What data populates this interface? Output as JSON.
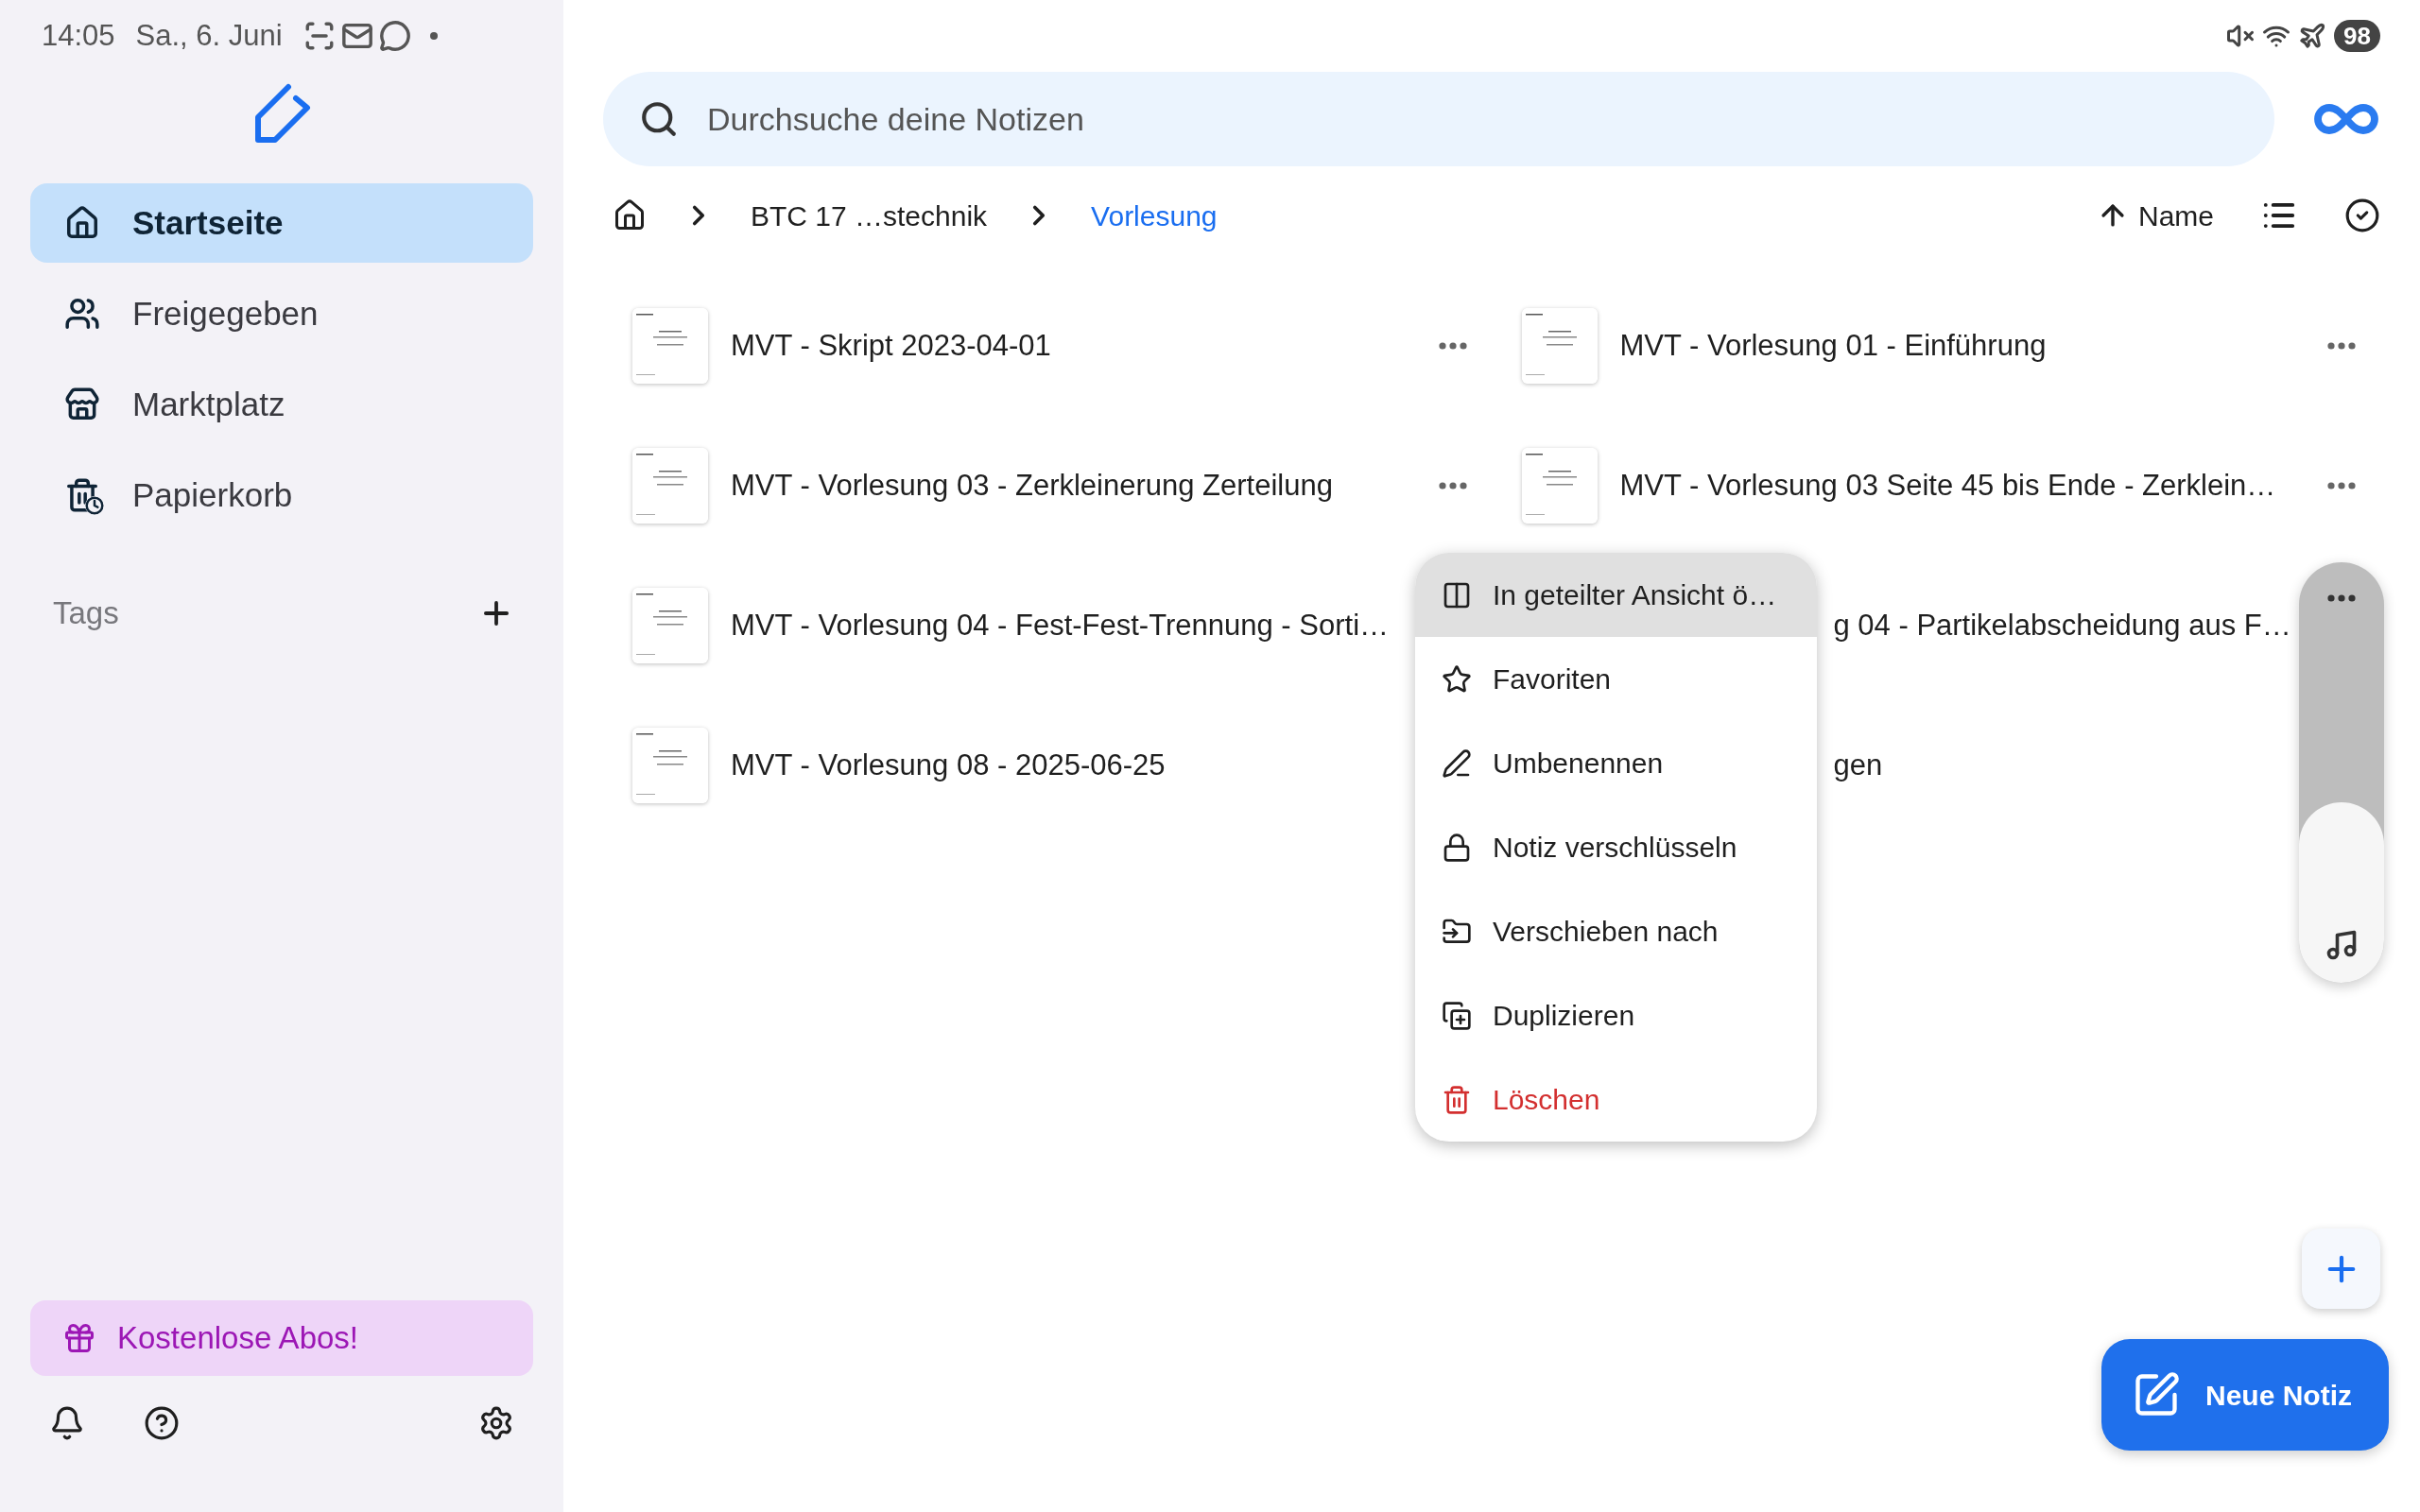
{
  "status_bar": {
    "time": "14:05",
    "date": "Sa., 6. Juni",
    "battery": "98"
  },
  "sidebar": {
    "items": [
      {
        "label": "Startseite",
        "selected": true
      },
      {
        "label": "Freigegeben",
        "selected": false
      },
      {
        "label": "Marktplatz",
        "selected": false
      },
      {
        "label": "Papierkorb",
        "selected": false
      }
    ],
    "tags_label": "Tags",
    "promo": "Kostenlose Abos!"
  },
  "search": {
    "placeholder": "Durchsuche deine Notizen"
  },
  "breadcrumb": [
    {
      "label": "BTC 17 …stechnik",
      "current": false
    },
    {
      "label": "Vorlesung",
      "current": true
    }
  ],
  "sort": {
    "label": "Name"
  },
  "notes": [
    {
      "title": "MVT - Skript 2023-04-01",
      "kind": "full"
    },
    {
      "title": "MVT - Vorlesung 01 - Einführung",
      "kind": "full"
    },
    {
      "title": "MVT - Vorlesung 03 - Zerkleinerung Zerteilung",
      "kind": "full"
    },
    {
      "title": "MVT - Vorlesung 03 Seite 45 bis Ende - Zerklein…",
      "kind": "full"
    },
    {
      "title": "MVT - Vorlesung 04 - Fest-Fest-Trennung - Sorti…",
      "kind": "covered"
    },
    {
      "title": "g 04 - Partikelabscheidung aus F…",
      "kind": "partial"
    },
    {
      "title": "MVT - Vorlesung 08 - 2025-06-25",
      "kind": "covered"
    },
    {
      "title": "gen",
      "kind": "partial"
    }
  ],
  "context_menu": {
    "items": [
      {
        "label": "In geteilter Ansicht ö…",
        "highlighted": true,
        "danger": false
      },
      {
        "label": "Favoriten",
        "highlighted": false,
        "danger": false
      },
      {
        "label": "Umbenennen",
        "highlighted": false,
        "danger": false
      },
      {
        "label": "Notiz verschlüsseln",
        "highlighted": false,
        "danger": false
      },
      {
        "label": "Verschieben nach",
        "highlighted": false,
        "danger": false
      },
      {
        "label": "Duplizieren",
        "highlighted": false,
        "danger": false
      },
      {
        "label": "Löschen",
        "highlighted": false,
        "danger": true
      }
    ]
  },
  "volume": {
    "level": 0.43
  },
  "new_note": {
    "label": "Neue Notiz"
  }
}
